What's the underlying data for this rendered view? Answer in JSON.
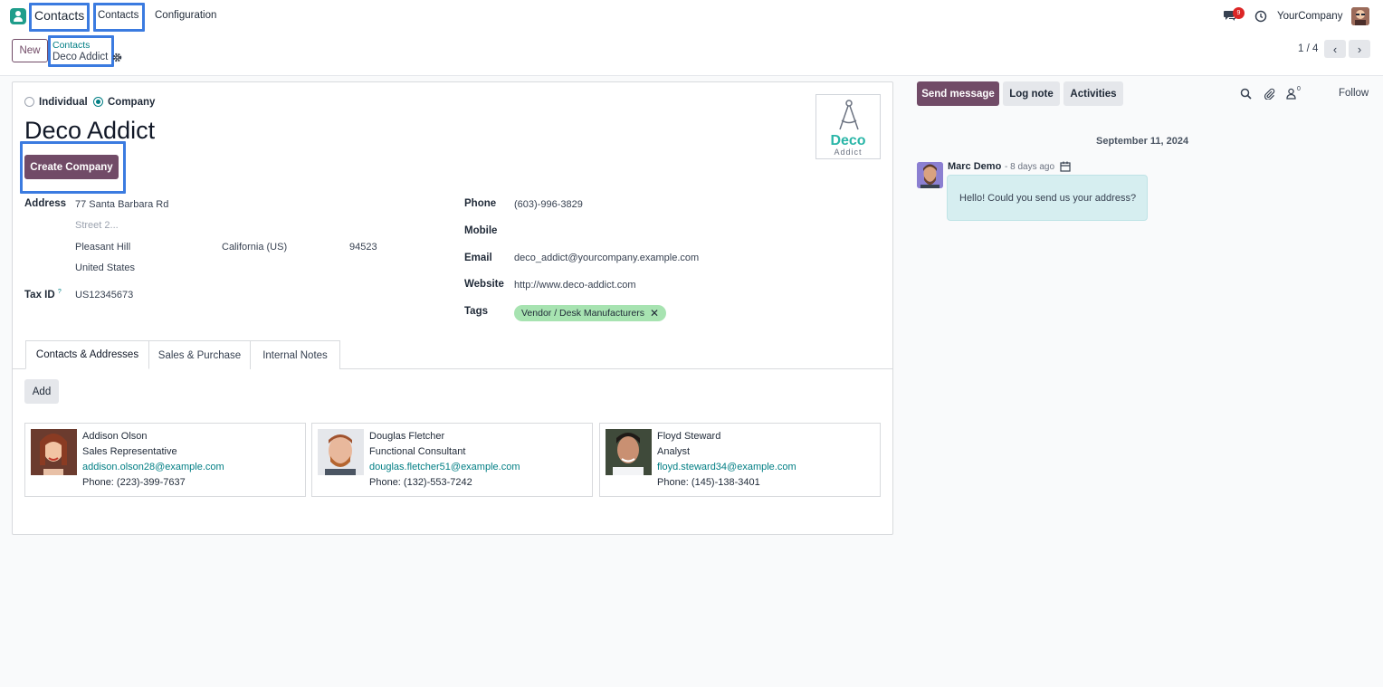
{
  "topbar": {
    "app_name": "Contacts",
    "menu": [
      "Contacts",
      "Configuration"
    ],
    "notification_count": "9",
    "company": "YourCompany"
  },
  "control": {
    "new_label": "New",
    "breadcrumb_parent": "Contacts",
    "breadcrumb_current": "Deco Addict",
    "pager": "1 / 4"
  },
  "form": {
    "type_options": [
      "Individual",
      "Company"
    ],
    "selected_type": "Company",
    "name": "Deco Addict",
    "create_company_label": "Create Company",
    "logo": {
      "line1": "Deco",
      "line2": "Addict"
    },
    "address_label": "Address",
    "street": "77 Santa Barbara Rd",
    "street2_placeholder": "Street 2...",
    "city": "Pleasant Hill",
    "state": "California (US)",
    "zip": "94523",
    "country": "United States",
    "tax_id_label": "Tax ID",
    "tax_id_help": "?",
    "tax_id": "US12345673",
    "phone_label": "Phone",
    "phone": "(603)-996-3829",
    "mobile_label": "Mobile",
    "mobile": "",
    "email_label": "Email",
    "email": "deco_addict@yourcompany.example.com",
    "website_label": "Website",
    "website": "http://www.deco-addict.com",
    "tags_label": "Tags",
    "tags": [
      "Vendor / Desk Manufacturers"
    ]
  },
  "tabs": [
    "Contacts & Addresses",
    "Sales & Purchase",
    "Internal Notes"
  ],
  "active_tab": "Contacts & Addresses",
  "add_label": "Add",
  "contacts": [
    {
      "name": "Addison Olson",
      "function": "Sales Representative",
      "email": "addison.olson28@example.com",
      "phone": "Phone: (223)-399-7637"
    },
    {
      "name": "Douglas Fletcher",
      "function": "Functional Consultant",
      "email": "douglas.fletcher51@example.com",
      "phone": "Phone: (132)-553-7242"
    },
    {
      "name": "Floyd Steward",
      "function": "Analyst",
      "email": "floyd.steward34@example.com",
      "phone": "Phone: (145)-138-3401"
    }
  ],
  "chatter": {
    "send_message": "Send message",
    "log_note": "Log note",
    "activities": "Activities",
    "follower_count": "0",
    "follow": "Follow",
    "date": "September 11, 2024",
    "message": {
      "author": "Marc Demo",
      "time": "- 8 days ago",
      "body": "Hello! Could you send us your address?"
    }
  },
  "colors": {
    "primary": "#714b67",
    "link": "#017e84",
    "highlight": "#3b7be0",
    "tag_bg": "#a7e3b1"
  }
}
